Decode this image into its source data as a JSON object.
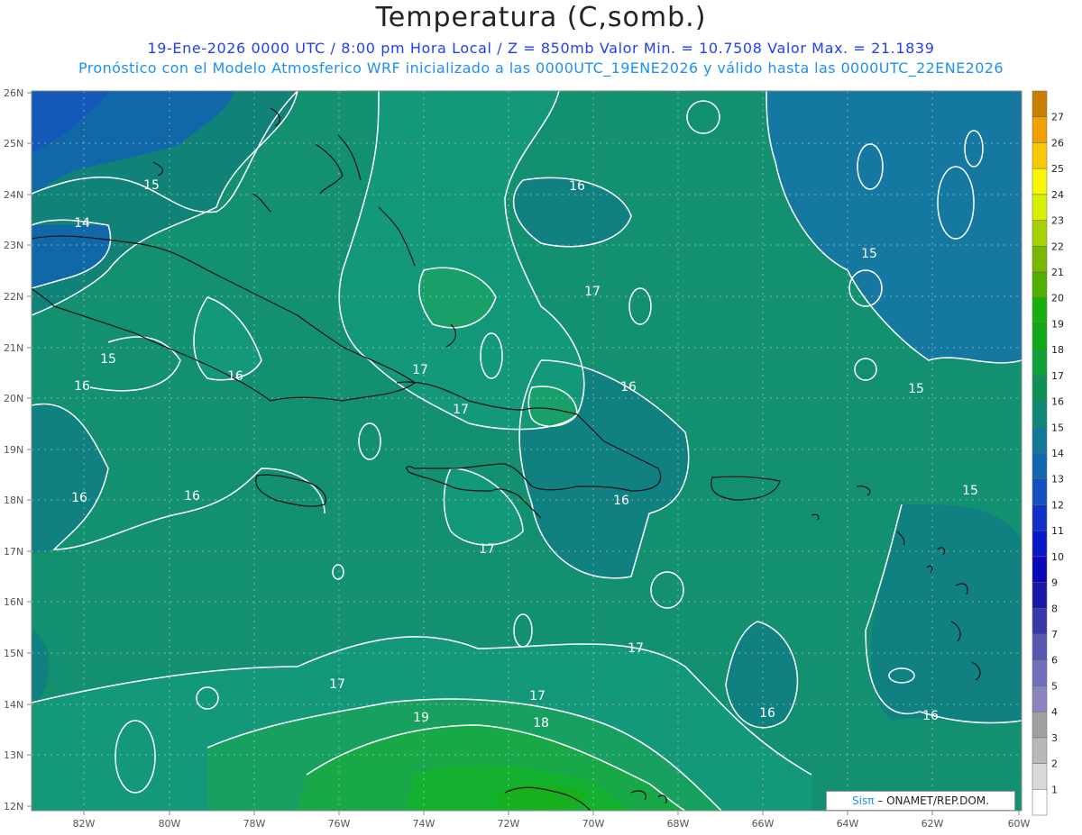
{
  "header": {
    "title": "Temperatura (C,somb.)",
    "subtitle_line1": "19-Ene-2026  0000 UTC / 8:00 pm Hora Local / Z = 850mb    Valor Min. = 10.7508  Valor Max. = 21.1839",
    "subtitle_line2": "Pronóstico con el Modelo Atmosferico WRF inicializado a las 0000UTC_19ENE2026 y válido hasta las  0000UTC_22ENE2026"
  },
  "map": {
    "lat_labels": [
      "26N",
      "25N",
      "24N",
      "23N",
      "22N",
      "21N",
      "20N",
      "19N",
      "18N",
      "17N",
      "16N",
      "15N",
      "14N",
      "13N",
      "12N"
    ],
    "lon_labels": [
      "82W",
      "80W",
      "78W",
      "76W",
      "74W",
      "72W",
      "70W",
      "68W",
      "66W",
      "64W",
      "62W",
      "60W"
    ],
    "contour_labels": [
      {
        "text": "15"
      },
      {
        "text": "14"
      },
      {
        "text": "15"
      },
      {
        "text": "16"
      },
      {
        "text": "16"
      },
      {
        "text": "16"
      },
      {
        "text": "16"
      },
      {
        "text": "17"
      },
      {
        "text": "17"
      },
      {
        "text": "16"
      },
      {
        "text": "17"
      },
      {
        "text": "15"
      },
      {
        "text": "15"
      },
      {
        "text": "16"
      },
      {
        "text": "15"
      },
      {
        "text": "17"
      },
      {
        "text": "17"
      },
      {
        "text": "17"
      },
      {
        "text": "19"
      },
      {
        "text": "18"
      },
      {
        "text": "17"
      },
      {
        "text": "16"
      },
      {
        "text": "16"
      },
      {
        "text": "16"
      }
    ]
  },
  "colorbar": {
    "labels": [
      "1",
      "2",
      "3",
      "4",
      "5",
      "6",
      "7",
      "8",
      "9",
      "10",
      "11",
      "12",
      "13",
      "14",
      "15",
      "16",
      "17",
      "18",
      "19",
      "20",
      "21",
      "22",
      "23",
      "24",
      "25",
      "26",
      "27"
    ],
    "colors": [
      "#ffffff",
      "#d9d9d9",
      "#b8b8b8",
      "#a0a0a0",
      "#8c84c0",
      "#7070b8",
      "#5858b0",
      "#3838a8",
      "#1818a8",
      "#0808b8",
      "#0818c8",
      "#1030c8",
      "#1450c0",
      "#1068b0",
      "#107898",
      "#108878",
      "#109058",
      "#10a038",
      "#10a818",
      "#18b010",
      "#50b000",
      "#78b800",
      "#a8d000",
      "#d8f000",
      "#f8f800",
      "#f8c800",
      "#f0a000",
      "#c88000"
    ]
  },
  "credit": {
    "brand": "Sisπ",
    "text": "– ONAMET/REP.DOM."
  }
}
